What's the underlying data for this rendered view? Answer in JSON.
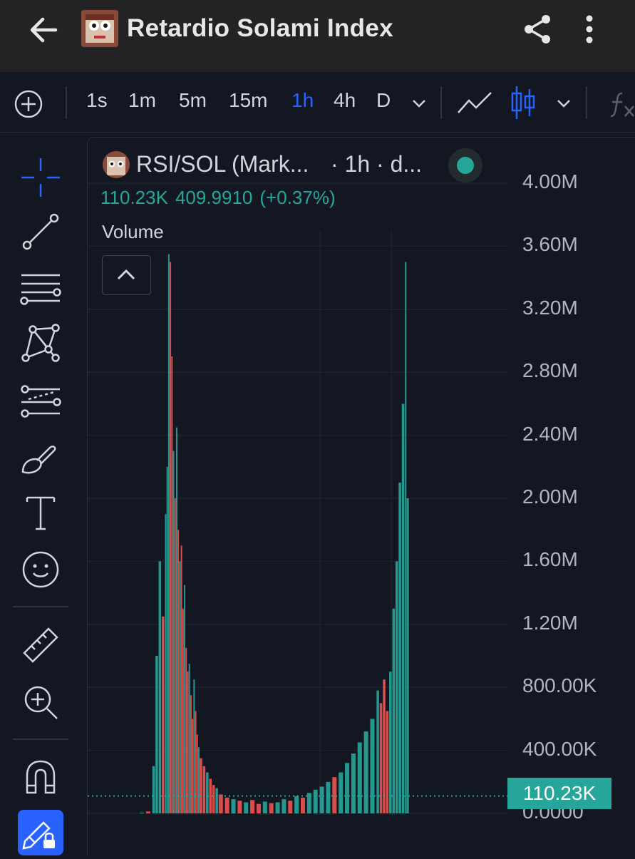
{
  "header": {
    "title": "Retardio Solami Index",
    "icons": [
      "back-arrow-icon",
      "token-avatar",
      "share-icon",
      "more-vertical-icon"
    ]
  },
  "toolbar": {
    "intervals": [
      "1s",
      "1m",
      "5m",
      "15m",
      "1h",
      "4h",
      "D"
    ],
    "active_interval": "1h",
    "active_color": "#2962ff",
    "icons": [
      "add-circle-icon",
      "chevron-down-icon",
      "line-chart-icon",
      "candles-icon",
      "chevron-down-icon",
      "fx-icon"
    ]
  },
  "sidebar": {
    "tools": [
      "crosshair-icon",
      "trend-line-icon",
      "horizontal-lines-icon",
      "pattern-icon",
      "fib-channel-icon",
      "brush-icon",
      "text-icon",
      "emoji-icon",
      "ruler-icon",
      "zoom-in-icon",
      "magnet-icon",
      "lock-drawing-icon"
    ]
  },
  "legend": {
    "symbol": "RSI/SOL (Mark...",
    "interval_suffix": "· 1h · d...",
    "volume_value": "110.23K",
    "price": "409.9910",
    "change": "(+0.37%)",
    "study": "Volume"
  },
  "chart_data": {
    "type": "bar",
    "series_name": "Volume",
    "y_ticks": [
      "4.00M",
      "3.60M",
      "3.20M",
      "2.80M",
      "2.40M",
      "2.00M",
      "1.60M",
      "1.20M",
      "800.00K",
      "400.00K",
      "0.0000"
    ],
    "ylim": [
      0,
      4000000
    ],
    "current_value_label": "110.23K",
    "current_value": 110230,
    "up_color": "#26a69a",
    "down_color": "#ef5350",
    "grid": true,
    "bars": [
      {
        "t": 0.0,
        "v": 5000,
        "up": true
      },
      {
        "t": 0.02,
        "v": 12000,
        "up": false
      },
      {
        "t": 0.04,
        "v": 300000,
        "up": true
      },
      {
        "t": 0.05,
        "v": 1000000,
        "up": true
      },
      {
        "t": 0.06,
        "v": 1600000,
        "up": true
      },
      {
        "t": 0.07,
        "v": 1250000,
        "up": false
      },
      {
        "t": 0.08,
        "v": 1900000,
        "up": true
      },
      {
        "t": 0.085,
        "v": 2200000,
        "up": true
      },
      {
        "t": 0.09,
        "v": 3550000,
        "up": true
      },
      {
        "t": 0.095,
        "v": 3500000,
        "up": false
      },
      {
        "t": 0.1,
        "v": 2900000,
        "up": false
      },
      {
        "t": 0.105,
        "v": 2300000,
        "up": true
      },
      {
        "t": 0.11,
        "v": 2000000,
        "up": false
      },
      {
        "t": 0.115,
        "v": 2450000,
        "up": true
      },
      {
        "t": 0.12,
        "v": 1800000,
        "up": false
      },
      {
        "t": 0.125,
        "v": 1600000,
        "up": true
      },
      {
        "t": 0.13,
        "v": 1700000,
        "up": false
      },
      {
        "t": 0.135,
        "v": 1300000,
        "up": false
      },
      {
        "t": 0.14,
        "v": 1450000,
        "up": true
      },
      {
        "t": 0.145,
        "v": 1050000,
        "up": false
      },
      {
        "t": 0.15,
        "v": 900000,
        "up": false
      },
      {
        "t": 0.155,
        "v": 950000,
        "up": true
      },
      {
        "t": 0.16,
        "v": 750000,
        "up": false
      },
      {
        "t": 0.165,
        "v": 600000,
        "up": false
      },
      {
        "t": 0.17,
        "v": 850000,
        "up": true
      },
      {
        "t": 0.175,
        "v": 650000,
        "up": false
      },
      {
        "t": 0.18,
        "v": 500000,
        "up": false
      },
      {
        "t": 0.185,
        "v": 420000,
        "up": true
      },
      {
        "t": 0.19,
        "v": 350000,
        "up": false
      },
      {
        "t": 0.2,
        "v": 300000,
        "up": false
      },
      {
        "t": 0.21,
        "v": 260000,
        "up": true
      },
      {
        "t": 0.22,
        "v": 220000,
        "up": false
      },
      {
        "t": 0.23,
        "v": 180000,
        "up": false
      },
      {
        "t": 0.24,
        "v": 160000,
        "up": true
      },
      {
        "t": 0.25,
        "v": 120000,
        "up": false
      },
      {
        "t": 0.27,
        "v": 100000,
        "up": false
      },
      {
        "t": 0.29,
        "v": 90000,
        "up": true
      },
      {
        "t": 0.31,
        "v": 80000,
        "up": false
      },
      {
        "t": 0.33,
        "v": 70000,
        "up": true
      },
      {
        "t": 0.35,
        "v": 85000,
        "up": false
      },
      {
        "t": 0.37,
        "v": 60000,
        "up": false
      },
      {
        "t": 0.39,
        "v": 75000,
        "up": true
      },
      {
        "t": 0.41,
        "v": 65000,
        "up": false
      },
      {
        "t": 0.43,
        "v": 70000,
        "up": true
      },
      {
        "t": 0.45,
        "v": 90000,
        "up": true
      },
      {
        "t": 0.47,
        "v": 80000,
        "up": false
      },
      {
        "t": 0.49,
        "v": 110000,
        "up": true
      },
      {
        "t": 0.51,
        "v": 100000,
        "up": false
      },
      {
        "t": 0.53,
        "v": 130000,
        "up": true
      },
      {
        "t": 0.55,
        "v": 150000,
        "up": true
      },
      {
        "t": 0.57,
        "v": 170000,
        "up": true
      },
      {
        "t": 0.59,
        "v": 200000,
        "up": true
      },
      {
        "t": 0.61,
        "v": 230000,
        "up": false
      },
      {
        "t": 0.63,
        "v": 260000,
        "up": true
      },
      {
        "t": 0.65,
        "v": 320000,
        "up": true
      },
      {
        "t": 0.67,
        "v": 380000,
        "up": true
      },
      {
        "t": 0.69,
        "v": 450000,
        "up": true
      },
      {
        "t": 0.71,
        "v": 520000,
        "up": true
      },
      {
        "t": 0.73,
        "v": 600000,
        "up": true
      },
      {
        "t": 0.75,
        "v": 780000,
        "up": true
      },
      {
        "t": 0.76,
        "v": 700000,
        "up": false
      },
      {
        "t": 0.77,
        "v": 850000,
        "up": false
      },
      {
        "t": 0.78,
        "v": 650000,
        "up": false
      },
      {
        "t": 0.79,
        "v": 900000,
        "up": true
      },
      {
        "t": 0.8,
        "v": 1300000,
        "up": true
      },
      {
        "t": 0.81,
        "v": 1600000,
        "up": true
      },
      {
        "t": 0.82,
        "v": 2100000,
        "up": true
      },
      {
        "t": 0.83,
        "v": 2600000,
        "up": true
      },
      {
        "t": 0.84,
        "v": 3500000,
        "up": true
      },
      {
        "t": 0.845,
        "v": 2000000,
        "up": true
      }
    ]
  }
}
